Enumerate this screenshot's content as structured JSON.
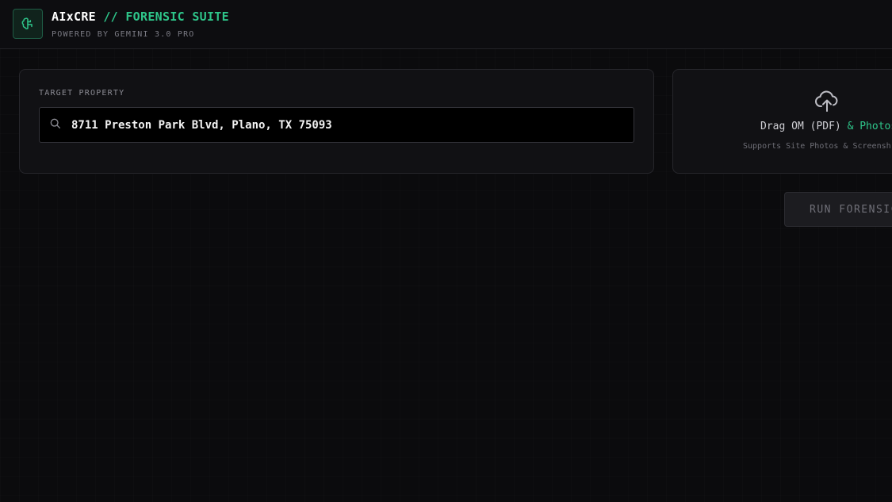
{
  "header": {
    "brand_primary": "AIxCRE",
    "brand_secondary": "// FORENSIC SUITE",
    "tagline": "POWERED BY GEMINI 3.0 PRO",
    "logo_icon": "brain-icon"
  },
  "target": {
    "label": "TARGET PROPERTY",
    "address_value": "8711 Preston Park Blvd, Plano, TX 75093",
    "search_icon": "search-icon"
  },
  "upload": {
    "icon": "cloud-upload-icon",
    "text_main": "Drag OM (PDF) ",
    "text_accent": "& Photos",
    "subtext": "Supports Site Photos & Screensh"
  },
  "actions": {
    "run_label": "RUN FORENSIC"
  },
  "colors": {
    "accent": "#2ec58a",
    "background": "#0b0b0d",
    "panel": "#111114"
  }
}
